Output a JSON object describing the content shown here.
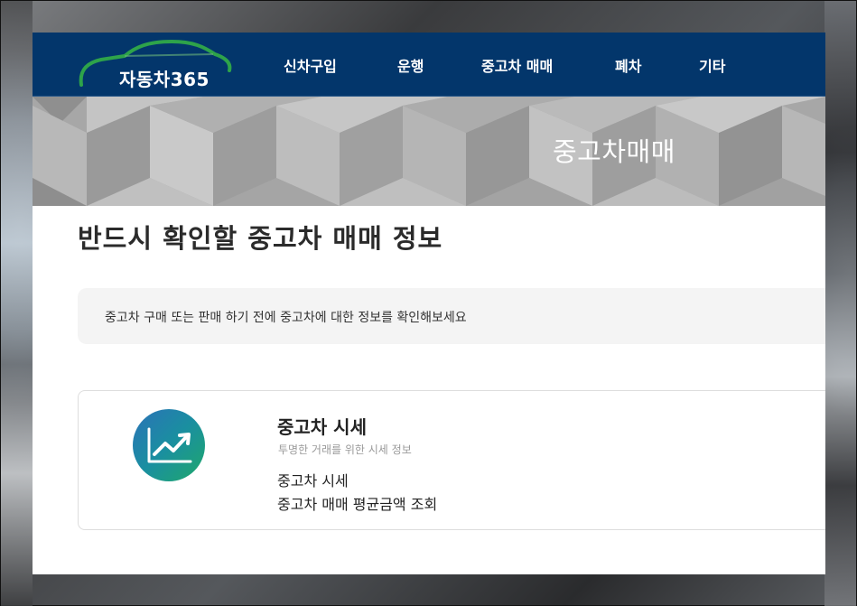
{
  "header": {
    "logo_text": "자동차365",
    "nav": [
      "신차구입",
      "운행",
      "중고차 매매",
      "폐차",
      "기타"
    ]
  },
  "hero": {
    "title": "중고차매매"
  },
  "main": {
    "title": "반드시 확인할 중고차 매매 정보",
    "notice": "중고차 구매 또는 판매 하기 전에 중고차에 대한 정보를 확인해보세요"
  },
  "card": {
    "icon": "chart-trend-icon",
    "title": "중고차 시세",
    "subtitle": "투명한 거래를 위한 시세 정보",
    "links": [
      "중고차 시세",
      "중고차 매매 평균금액 조회"
    ]
  },
  "colors": {
    "header_bg": "#03366b",
    "logo_arc": "#2ea34a",
    "icon_gradient_start": "#2b72b8",
    "icon_gradient_end": "#1fa86a"
  }
}
